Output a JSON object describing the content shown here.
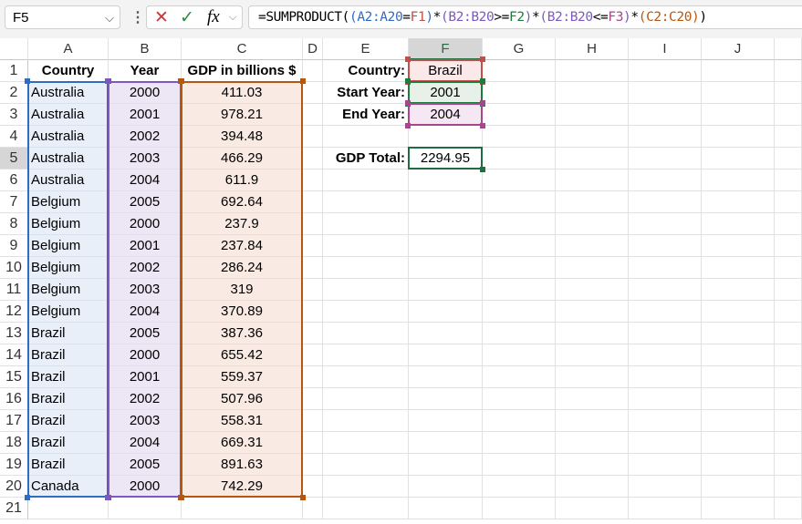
{
  "name_box": "F5",
  "formula_bar": {
    "cancel_icon": "✕",
    "enter_icon": "✓",
    "fx_label": "fx",
    "parts": [
      {
        "t": "=SUMPRODUCT(",
        "c": "#000000"
      },
      {
        "t": "(",
        "c": "#2f6cc4"
      },
      {
        "t": "A2:A20",
        "c": "#2f6cc4"
      },
      {
        "t": "=",
        "c": "#000000"
      },
      {
        "t": "F1",
        "c": "#c0504d"
      },
      {
        "t": ")",
        "c": "#2f6cc4"
      },
      {
        "t": "*",
        "c": "#000000"
      },
      {
        "t": "(",
        "c": "#7e57c2"
      },
      {
        "t": "B2:B20",
        "c": "#7e57c2"
      },
      {
        "t": ">=",
        "c": "#000000"
      },
      {
        "t": "F2",
        "c": "#1e7b3e"
      },
      {
        "t": ")",
        "c": "#7e57c2"
      },
      {
        "t": "*",
        "c": "#000000"
      },
      {
        "t": "(",
        "c": "#7e57c2"
      },
      {
        "t": "B2:B20",
        "c": "#7e57c2"
      },
      {
        "t": "<=",
        "c": "#000000"
      },
      {
        "t": "F3",
        "c": "#a8458f"
      },
      {
        "t": ")",
        "c": "#7e57c2"
      },
      {
        "t": "*",
        "c": "#000000"
      },
      {
        "t": "(",
        "c": "#b9560e"
      },
      {
        "t": "C2:C20",
        "c": "#b9560e"
      },
      {
        "t": ")",
        "c": "#b9560e"
      },
      {
        "t": ")",
        "c": "#000000"
      }
    ]
  },
  "columns": [
    "A",
    "B",
    "C",
    "D",
    "E",
    "F",
    "G",
    "H",
    "I",
    "J"
  ],
  "row_numbers": [
    "1",
    "2",
    "3",
    "4",
    "5",
    "6",
    "7",
    "8",
    "9",
    "10",
    "11",
    "12",
    "13",
    "14",
    "15",
    "16",
    "17",
    "18",
    "19",
    "20",
    "21"
  ],
  "table": {
    "headers": [
      "Country",
      "Year",
      "GDP in billions $"
    ],
    "rows": [
      [
        "Australia",
        "2000",
        "411.03"
      ],
      [
        "Australia",
        "2001",
        "978.21"
      ],
      [
        "Australia",
        "2002",
        "394.48"
      ],
      [
        "Australia",
        "2003",
        "466.29"
      ],
      [
        "Australia",
        "2004",
        "611.9"
      ],
      [
        "Belgium",
        "2005",
        "692.64"
      ],
      [
        "Belgium",
        "2000",
        "237.9"
      ],
      [
        "Belgium",
        "2001",
        "237.84"
      ],
      [
        "Belgium",
        "2002",
        "286.24"
      ],
      [
        "Belgium",
        "2003",
        "319"
      ],
      [
        "Belgium",
        "2004",
        "370.89"
      ],
      [
        "Brazil",
        "2005",
        "387.36"
      ],
      [
        "Brazil",
        "2000",
        "655.42"
      ],
      [
        "Brazil",
        "2001",
        "559.37"
      ],
      [
        "Brazil",
        "2002",
        "507.96"
      ],
      [
        "Brazil",
        "2003",
        "558.31"
      ],
      [
        "Brazil",
        "2004",
        "669.31"
      ],
      [
        "Brazil",
        "2005",
        "891.63"
      ],
      [
        "Canada",
        "2000",
        "742.29"
      ]
    ]
  },
  "criteria": [
    {
      "label": "Country:",
      "value": "Brazil"
    },
    {
      "label": "Start Year:",
      "value": "2001"
    },
    {
      "label": "End Year:",
      "value": "2004"
    }
  ],
  "result": {
    "label": "GDP Total:",
    "value": "2294.95"
  },
  "colors": {
    "blue": "#2f6cc4",
    "blue_fill": "#e9eff9",
    "purple": "#7e57c2",
    "purple_fill": "#ece6f5",
    "orange": "#b9560e",
    "orange_fill": "#f9ebe4",
    "red": "#c0504d",
    "red_fill": "#fbe9e9",
    "green": "#1e7b3e",
    "green_fill": "#e7f1e9",
    "magenta": "#a8458f",
    "magenta_fill": "#f6e8f2",
    "select": "#1e6e42"
  }
}
